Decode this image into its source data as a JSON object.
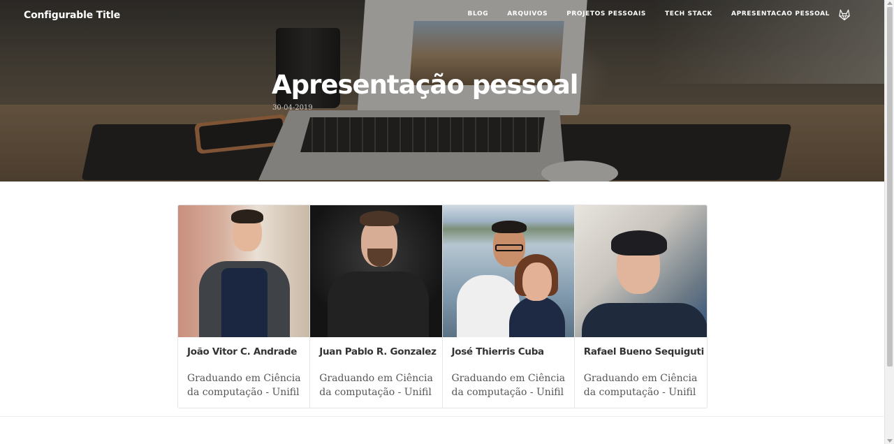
{
  "site": {
    "title": "Configurable Title"
  },
  "nav": {
    "items": [
      {
        "label": "BLOG"
      },
      {
        "label": "ARQUIVOS"
      },
      {
        "label": "PROJETOS PESSOAIS"
      },
      {
        "label": "TECH STACK"
      },
      {
        "label": "APRESENTACAO PESSOAL"
      }
    ],
    "icon": "gitlab-fox-icon"
  },
  "post": {
    "title": "Apresentação pessoal",
    "date": "30-04-2019"
  },
  "people": [
    {
      "name": "João Vitor C. Andrade",
      "desc": "Graduando em Ciência da computação - Unifil"
    },
    {
      "name": "Juan Pablo R. Gonzalez",
      "desc": "Graduando em Ciência da computação - Unifil"
    },
    {
      "name": "José Thierris Cuba",
      "desc": "Graduando em Ciência da computação - Unifil"
    },
    {
      "name": "Rafael Bueno Sequiguti",
      "desc": "Graduando em Ciência da computação - Unifil"
    }
  ],
  "colors": {
    "nav_text": "#ffffff",
    "card_border": "#e4e4e4",
    "name_text": "#333333",
    "desc_text": "#555555"
  }
}
